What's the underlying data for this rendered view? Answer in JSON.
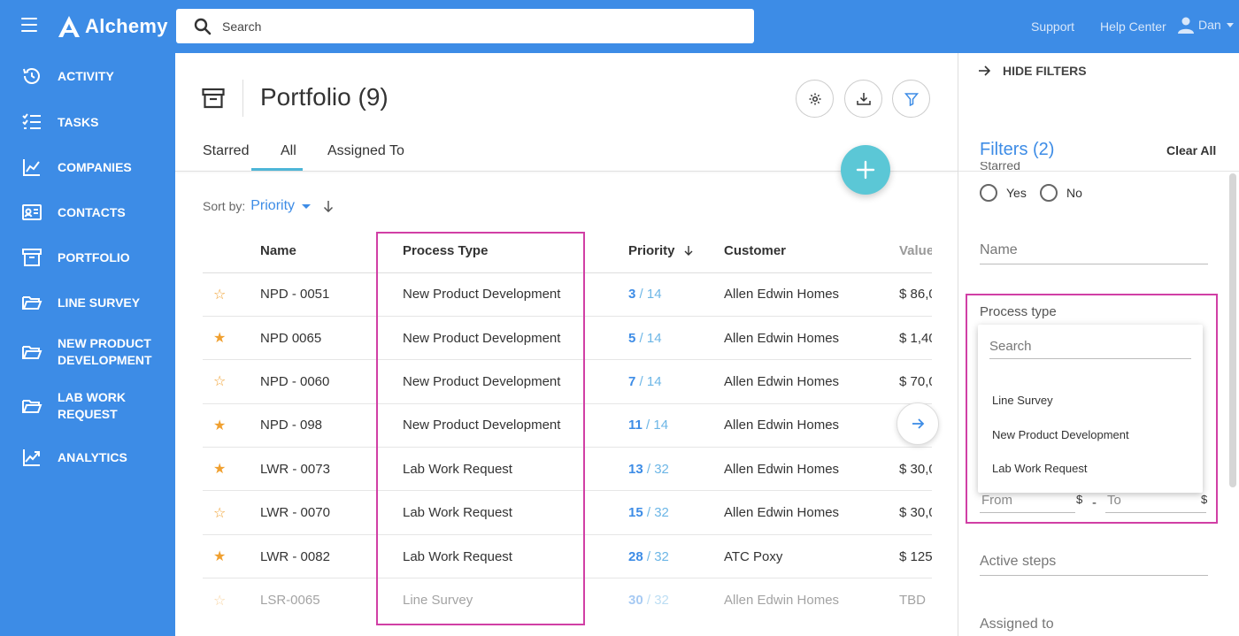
{
  "colors": {
    "brand": "#3d8ce6",
    "accent": "#5bc7d6",
    "highlight": "#d13fa5",
    "star": "#f0a030"
  },
  "topbar": {
    "app_name": "Alchemy",
    "search_placeholder": "Search",
    "support": "Support",
    "help_center": "Help Center",
    "user": "Dan"
  },
  "sidebar": {
    "items": [
      {
        "label": "ACTIVITY",
        "icon": "history-icon"
      },
      {
        "label": "TASKS",
        "icon": "checklist-icon"
      },
      {
        "label": "COMPANIES",
        "icon": "chart-icon"
      },
      {
        "label": "CONTACTS",
        "icon": "contact-card-icon"
      },
      {
        "label": "PORTFOLIO",
        "icon": "archive-box-icon"
      },
      {
        "label": "LINE SURVEY",
        "icon": "folder-open-icon"
      },
      {
        "label": "NEW PRODUCT\nDEVELOPMENT",
        "icon": "folder-open-icon"
      },
      {
        "label": "LAB WORK\nREQUEST",
        "icon": "folder-open-icon"
      },
      {
        "label": "ANALYTICS",
        "icon": "trend-line-icon"
      }
    ]
  },
  "main": {
    "title": "Portfolio (9)",
    "tabs": [
      "Starred",
      "All",
      "Assigned To"
    ],
    "active_tab": "All",
    "sort_label": "Sort by:",
    "sort_value": "Priority",
    "columns": [
      "Name",
      "Process Type",
      "Priority",
      "Customer",
      "Value"
    ],
    "rows": [
      {
        "starred": false,
        "name": "NPD - 0051",
        "process": "New Product Development",
        "prio": "3",
        "prio_total": "/ 14",
        "customer": "Allen Edwin Homes",
        "value": "$ 86,0"
      },
      {
        "starred": true,
        "name": "NPD 0065",
        "process": "New Product Development",
        "prio": "5",
        "prio_total": "/ 14",
        "customer": "Allen Edwin Homes",
        "value": "$ 1,40"
      },
      {
        "starred": false,
        "name": "NPD - 0060",
        "process": "New Product Development",
        "prio": "7",
        "prio_total": "/ 14",
        "customer": "Allen Edwin Homes",
        "value": "$ 70,0"
      },
      {
        "starred": true,
        "name": "NPD - 098",
        "process": "New Product Development",
        "prio": "11",
        "prio_total": "/ 14",
        "customer": "Allen Edwin Homes",
        "value": ""
      },
      {
        "starred": true,
        "name": "LWR - 0073",
        "process": "Lab Work Request",
        "prio": "13",
        "prio_total": "/ 32",
        "customer": "Allen Edwin Homes",
        "value": "$ 30,0"
      },
      {
        "starred": false,
        "name": "LWR - 0070",
        "process": "Lab Work Request",
        "prio": "15",
        "prio_total": "/ 32",
        "customer": "Allen Edwin Homes",
        "value": "$ 30,0"
      },
      {
        "starred": true,
        "name": "LWR - 0082",
        "process": "Lab Work Request",
        "prio": "28",
        "prio_total": "/ 32",
        "customer": "ATC Poxy",
        "value": "$ 125"
      },
      {
        "starred": false,
        "name": "LSR-0065",
        "process": "Line Survey",
        "prio": "30",
        "prio_total": "/ 32",
        "customer": "Allen Edwin Homes",
        "value": "TBD"
      }
    ]
  },
  "filters": {
    "hide_label": "HIDE FILTERS",
    "title": "Filters (2)",
    "clear_all": "Clear All",
    "starred_label": "Starred",
    "yes": "Yes",
    "no": "No",
    "name_placeholder": "Name",
    "process_type_label": "Process type",
    "dropdown_search_placeholder": "Search",
    "process_options": [
      "Line Survey",
      "New Product Development",
      "Lab Work Request"
    ],
    "from_placeholder": "From",
    "to_placeholder": "To",
    "currency": "$",
    "range_sep": "-",
    "active_steps": "Active steps",
    "assigned_to": "Assigned to"
  }
}
